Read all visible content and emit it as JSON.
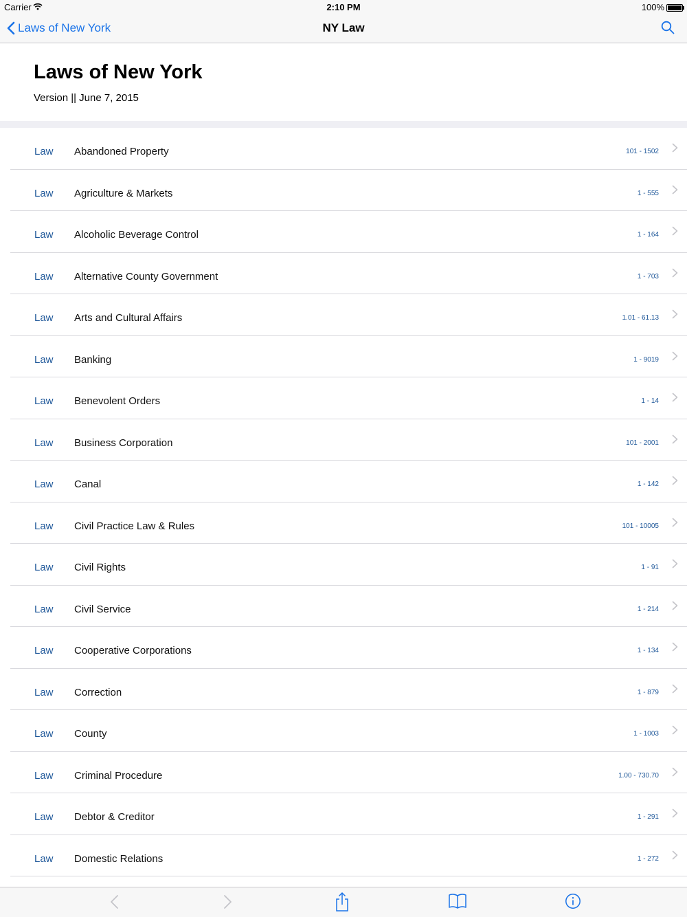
{
  "status": {
    "carrier": "Carrier",
    "time": "2:10 PM",
    "battery": "100%"
  },
  "nav": {
    "back_label": "Laws of New York",
    "title": "NY Law"
  },
  "header": {
    "title": "Laws of New York",
    "version": "Version || June 7, 2015"
  },
  "items": [
    {
      "tag": "Law",
      "name": "Abandoned Property",
      "range": "101 - 1502"
    },
    {
      "tag": "Law",
      "name": "Agriculture & Markets",
      "range": "1 - 555"
    },
    {
      "tag": "Law",
      "name": "Alcoholic Beverage Control",
      "range": "1 - 164"
    },
    {
      "tag": "Law",
      "name": "Alternative County Government",
      "range": "1 - 703"
    },
    {
      "tag": "Law",
      "name": "Arts and Cultural Affairs",
      "range": "1.01 - 61.13"
    },
    {
      "tag": "Law",
      "name": "Banking",
      "range": "1 - 9019"
    },
    {
      "tag": "Law",
      "name": "Benevolent Orders",
      "range": "1 - 14"
    },
    {
      "tag": "Law",
      "name": "Business Corporation",
      "range": "101 - 2001"
    },
    {
      "tag": "Law",
      "name": "Canal",
      "range": "1 - 142"
    },
    {
      "tag": "Law",
      "name": "Civil Practice Law & Rules",
      "range": "101 - 10005"
    },
    {
      "tag": "Law",
      "name": "Civil Rights",
      "range": "1 - 91"
    },
    {
      "tag": "Law",
      "name": "Civil Service",
      "range": "1 - 214"
    },
    {
      "tag": "Law",
      "name": "Cooperative Corporations",
      "range": "1 - 134"
    },
    {
      "tag": "Law",
      "name": "Correction",
      "range": "1 - 879"
    },
    {
      "tag": "Law",
      "name": "County",
      "range": "1 - 1003"
    },
    {
      "tag": "Law",
      "name": "Criminal Procedure",
      "range": "1.00 - 730.70"
    },
    {
      "tag": "Law",
      "name": "Debtor & Creditor",
      "range": "1 - 291"
    },
    {
      "tag": "Law",
      "name": "Domestic Relations",
      "range": "1 - 272"
    }
  ],
  "toolbar": {
    "icons": [
      "back-arrow-icon",
      "forward-arrow-icon",
      "share-icon",
      "book-icon",
      "info-icon"
    ]
  },
  "colors": {
    "accent": "#1a73e8",
    "tag": "#1e5799",
    "band": "#efeff4"
  }
}
